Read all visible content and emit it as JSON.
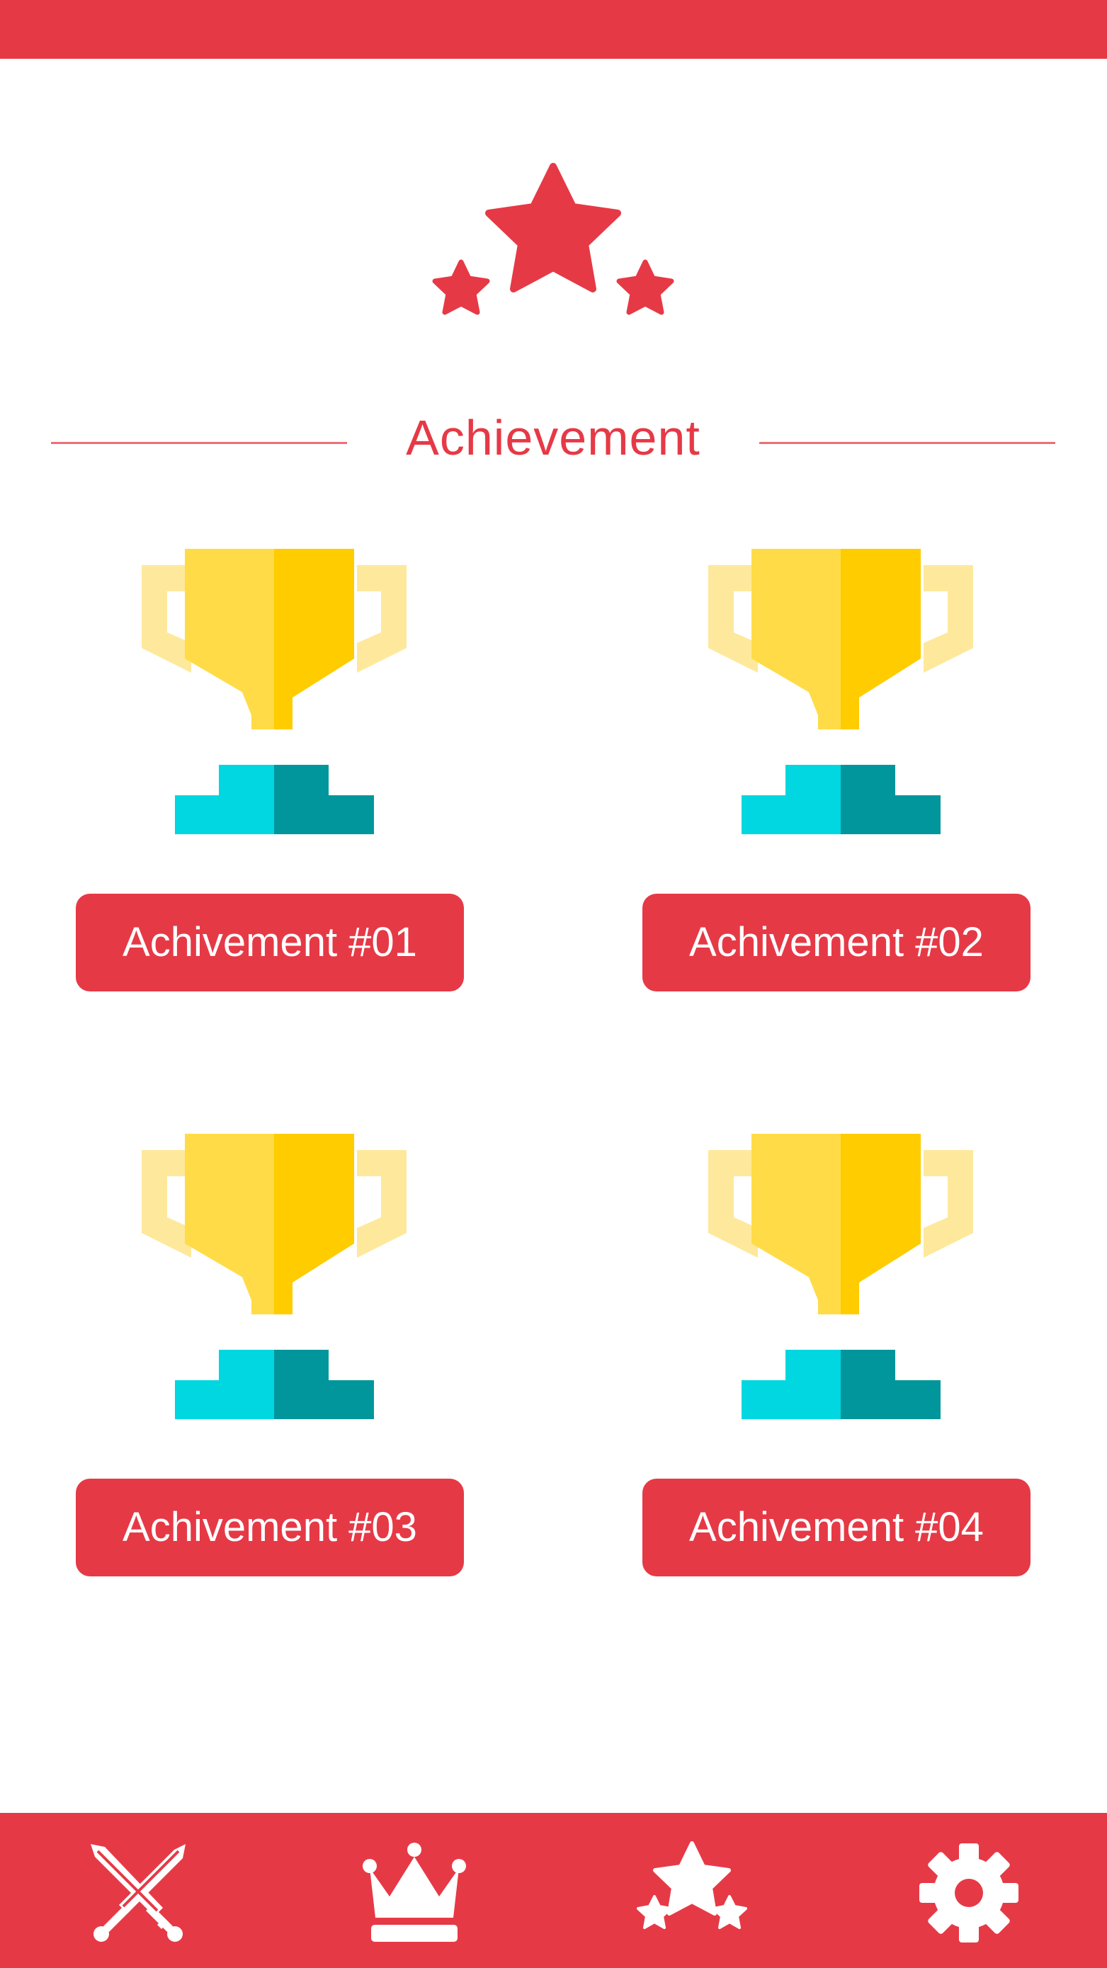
{
  "app": {
    "page_title": "Achievement"
  },
  "colors": {
    "accent": "#e63946",
    "trophy_light": "#ffdb47",
    "trophy_dark": "#ffcc00",
    "trophy_handle": "#fee89b",
    "base_light": "#00d7e0",
    "base_dark": "#00969b",
    "divider": "#ee6e78"
  },
  "achievements": [
    {
      "label": "Achivement #01",
      "icon": "trophy-icon"
    },
    {
      "label": "Achivement #02",
      "icon": "trophy-icon"
    },
    {
      "label": "Achivement #03",
      "icon": "trophy-icon"
    },
    {
      "label": "Achivement #04",
      "icon": "trophy-icon"
    }
  ],
  "bottom_nav": [
    {
      "icon": "crossed-swords-icon"
    },
    {
      "icon": "crown-icon"
    },
    {
      "icon": "stars-icon",
      "active": true
    },
    {
      "icon": "gear-icon"
    }
  ]
}
